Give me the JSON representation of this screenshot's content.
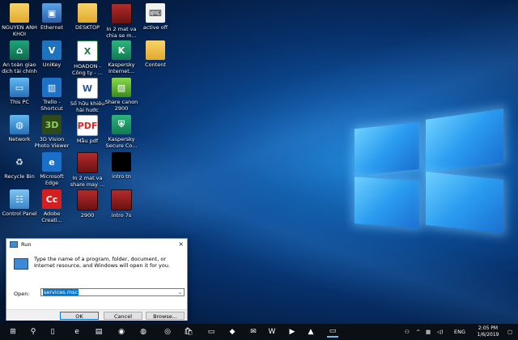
{
  "desktop": {
    "icons": [
      {
        "label": "NGUYEN ANH KHOI",
        "icon": "user-folder-icon",
        "col": 0,
        "row": 0
      },
      {
        "label": "Ethernet",
        "icon": "ethernet-icon",
        "col": 1,
        "row": 0
      },
      {
        "label": "DESKTOP",
        "icon": "shortcut-folder-icon",
        "col": 2,
        "row": 0
      },
      {
        "label": "In 2 mat va chia se m...",
        "icon": "video-file-icon",
        "col": 3,
        "row": 0
      },
      {
        "label": "active off",
        "icon": "active-off-icon",
        "col": 4,
        "row": 0
      },
      {
        "label": "An toàn giao dịch tài chính",
        "icon": "kaspersky-safe-money-icon",
        "col": 0,
        "row": 1
      },
      {
        "label": "UniKey",
        "icon": "unikey-icon",
        "col": 1,
        "row": 1
      },
      {
        "label": "HOADON - Công ty - ...",
        "icon": "excel-file-icon",
        "col": 2,
        "row": 1
      },
      {
        "label": "Kaspersky Internet...",
        "icon": "kaspersky-internet-icon",
        "col": 3,
        "row": 1
      },
      {
        "label": "Content",
        "icon": "folder-icon",
        "col": 4,
        "row": 1
      },
      {
        "label": "This PC",
        "icon": "this-pc-icon",
        "col": 0,
        "row": 2
      },
      {
        "label": "Trello - Shortcut",
        "icon": "trello-icon",
        "col": 1,
        "row": 2
      },
      {
        "label": "Sổ hữu khiêu hài hước",
        "icon": "word-file-icon",
        "col": 2,
        "row": 2
      },
      {
        "label": "Share canon 2900",
        "icon": "image-file-icon",
        "col": 3,
        "row": 2
      },
      {
        "label": "Network",
        "icon": "network-icon",
        "col": 0,
        "row": 3
      },
      {
        "label": "3D Vision Photo Viewer",
        "icon": "3d-vision-icon",
        "col": 1,
        "row": 3
      },
      {
        "label": "Mẫu pdf",
        "icon": "pdf-file-icon",
        "col": 2,
        "row": 3
      },
      {
        "label": "Kaspersky Secure Co...",
        "icon": "kaspersky-secure-icon",
        "col": 3,
        "row": 3
      },
      {
        "label": "Recycle Bin",
        "icon": "recycle-bin-icon",
        "col": 0,
        "row": 4
      },
      {
        "label": "Microsoft Edge",
        "icon": "edge-icon",
        "col": 1,
        "row": 4
      },
      {
        "label": "In 2 mat va share may ...",
        "icon": "video-file-icon",
        "col": 2,
        "row": 4
      },
      {
        "label": "intro tn",
        "icon": "black-video-icon",
        "col": 3,
        "row": 4
      },
      {
        "label": "Control Panel",
        "icon": "control-panel-icon",
        "col": 0,
        "row": 5
      },
      {
        "label": "Adobe Creati...",
        "icon": "adobe-cc-icon",
        "col": 1,
        "row": 5
      },
      {
        "label": "2900",
        "icon": "video-file-icon",
        "col": 2,
        "row": 5
      },
      {
        "label": "intro 7s",
        "icon": "video-file-icon",
        "col": 3,
        "row": 5
      }
    ]
  },
  "run_dialog": {
    "title": "Run",
    "close": "×",
    "description": "Type the name of a program, folder, document, or Internet resource, and Windows will open it for you.",
    "open_label": "Open:",
    "open_value": "services.msc",
    "ok_label": "OK",
    "cancel_label": "Cancel",
    "browse_label": "Browse..."
  },
  "taskbar": {
    "apps": [
      {
        "icon": "start-icon",
        "glyph": "⊞"
      },
      {
        "icon": "search-icon",
        "glyph": "⚲"
      },
      {
        "icon": "task-view-icon",
        "glyph": "▯"
      },
      {
        "icon": "edge-icon",
        "glyph": "e"
      },
      {
        "icon": "file-explorer-icon",
        "glyph": "▤"
      },
      {
        "icon": "chrome-icon",
        "glyph": "◉"
      },
      {
        "icon": "firefox-icon",
        "glyph": "◍"
      },
      {
        "icon": "firefox-orange-icon",
        "glyph": "◎"
      },
      {
        "icon": "store-icon",
        "glyph": "🛍"
      },
      {
        "icon": "photos-icon",
        "glyph": "▭"
      },
      {
        "icon": "app-icon",
        "glyph": "◆"
      },
      {
        "icon": "mail-icon",
        "glyph": "✉"
      },
      {
        "icon": "word-icon",
        "glyph": "W"
      },
      {
        "icon": "media-icon",
        "glyph": "▶"
      },
      {
        "icon": "image-viewer-icon",
        "glyph": "▲"
      },
      {
        "icon": "run-icon",
        "glyph": "▭"
      }
    ],
    "tray": {
      "people": "⚇",
      "chevron": "^",
      "network": "▦",
      "volume": "◁)",
      "language": "ENG",
      "time": "2:05 PM",
      "date": "1/6/2019",
      "notification": "▢"
    }
  }
}
